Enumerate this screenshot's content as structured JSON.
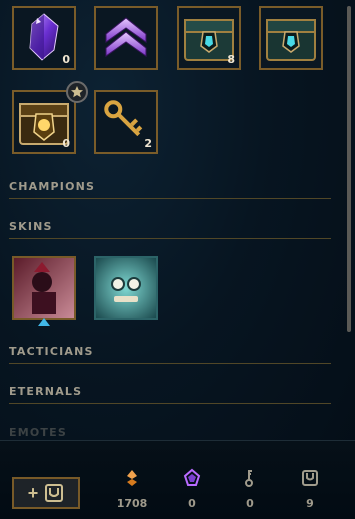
{
  "loot_items": [
    {
      "name": "Mythic Essence / Gemstone",
      "count": "0"
    },
    {
      "name": "Prestige Emblem",
      "count": ""
    },
    {
      "name": "Hextech Chest",
      "count": "8"
    },
    {
      "name": "Masterwork Chest",
      "count": ""
    },
    {
      "name": "Hextech Chest (Gold)",
      "count": "0"
    },
    {
      "name": "Key Fragment",
      "count": "2"
    }
  ],
  "sections": {
    "champions": "CHAMPIONS",
    "skins": "SKINS",
    "tacticians": "TACTICIANS",
    "eternals": "ETERNALS",
    "emotes": "EMOTES"
  },
  "skins": [
    {
      "name": "Skin shard 1"
    },
    {
      "name": "Skin shard 2"
    }
  ],
  "bottom_bar": {
    "craft_plus": "+",
    "currencies": [
      {
        "name": "orange-essence",
        "value": "1708"
      },
      {
        "name": "mythic-essence",
        "value": "0"
      },
      {
        "name": "key",
        "value": "0"
      },
      {
        "name": "chest",
        "value": "9"
      }
    ]
  },
  "colors": {
    "gold": "#c8aa6e",
    "border_gold": "#785a28",
    "text_muted": "#a09b8c",
    "orange_essence": "#f0a24d",
    "mythic": "#b96bff"
  }
}
